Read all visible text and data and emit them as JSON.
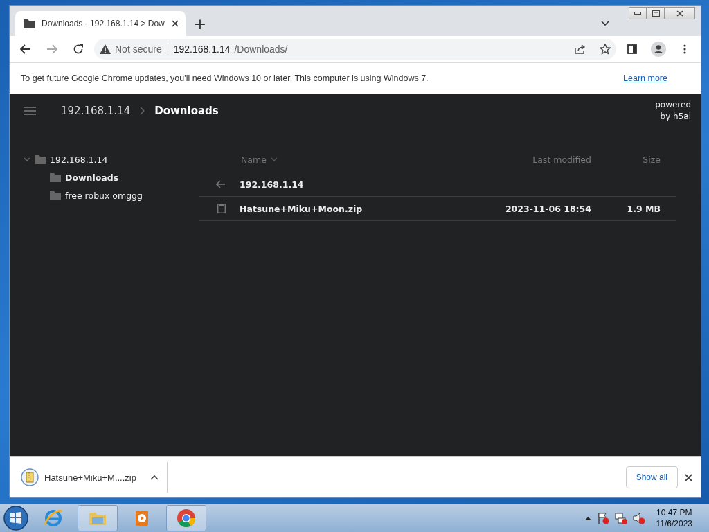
{
  "browser": {
    "tabs": [
      {
        "title": "Downloads - 192.168.1.14 > Dow",
        "selected": true
      }
    ],
    "new_tab": "+",
    "address_bar": {
      "security": "Not secure",
      "host": "192.168.1.14",
      "path": "/Downloads/"
    },
    "infobar": {
      "message": "To get future Google Chrome updates, you'll need Windows 10 or later. This computer is using Windows 7.",
      "link": "Learn more"
    }
  },
  "page": {
    "breadcrumb": [
      {
        "label": "192.168.1.14",
        "current": false
      },
      {
        "label": "Downloads",
        "current": true
      }
    ],
    "powered_by": "powered by h5ai",
    "tree": [
      {
        "label": "192.168.1.14",
        "expanded": true,
        "selected": false,
        "children": [
          {
            "label": "Downloads",
            "selected": true
          },
          {
            "label": "free robux omggg",
            "selected": false
          }
        ]
      }
    ],
    "columns": [
      {
        "label": "Name",
        "sorted": true
      },
      {
        "label": "Last modified",
        "sorted": false
      },
      {
        "label": "Size",
        "sorted": false
      }
    ],
    "parent_row": {
      "label": "192.168.1.14"
    },
    "files": [
      {
        "name": "Hatsune+Miku+Moon.zip",
        "modified": "2023-11-06 18:54",
        "size": "1.9 MB"
      }
    ]
  },
  "download_shelf": {
    "items": [
      {
        "name": "Hatsune+Miku+M....zip"
      }
    ],
    "show_all": "Show all"
  },
  "taskbar": {
    "apps": [
      {
        "kind": "ie",
        "active": false
      },
      {
        "kind": "explorer",
        "active": true
      },
      {
        "kind": "media",
        "active": false
      },
      {
        "kind": "chrome",
        "active": true
      }
    ],
    "time": "10:47 PM",
    "date": "11/6/2023"
  }
}
